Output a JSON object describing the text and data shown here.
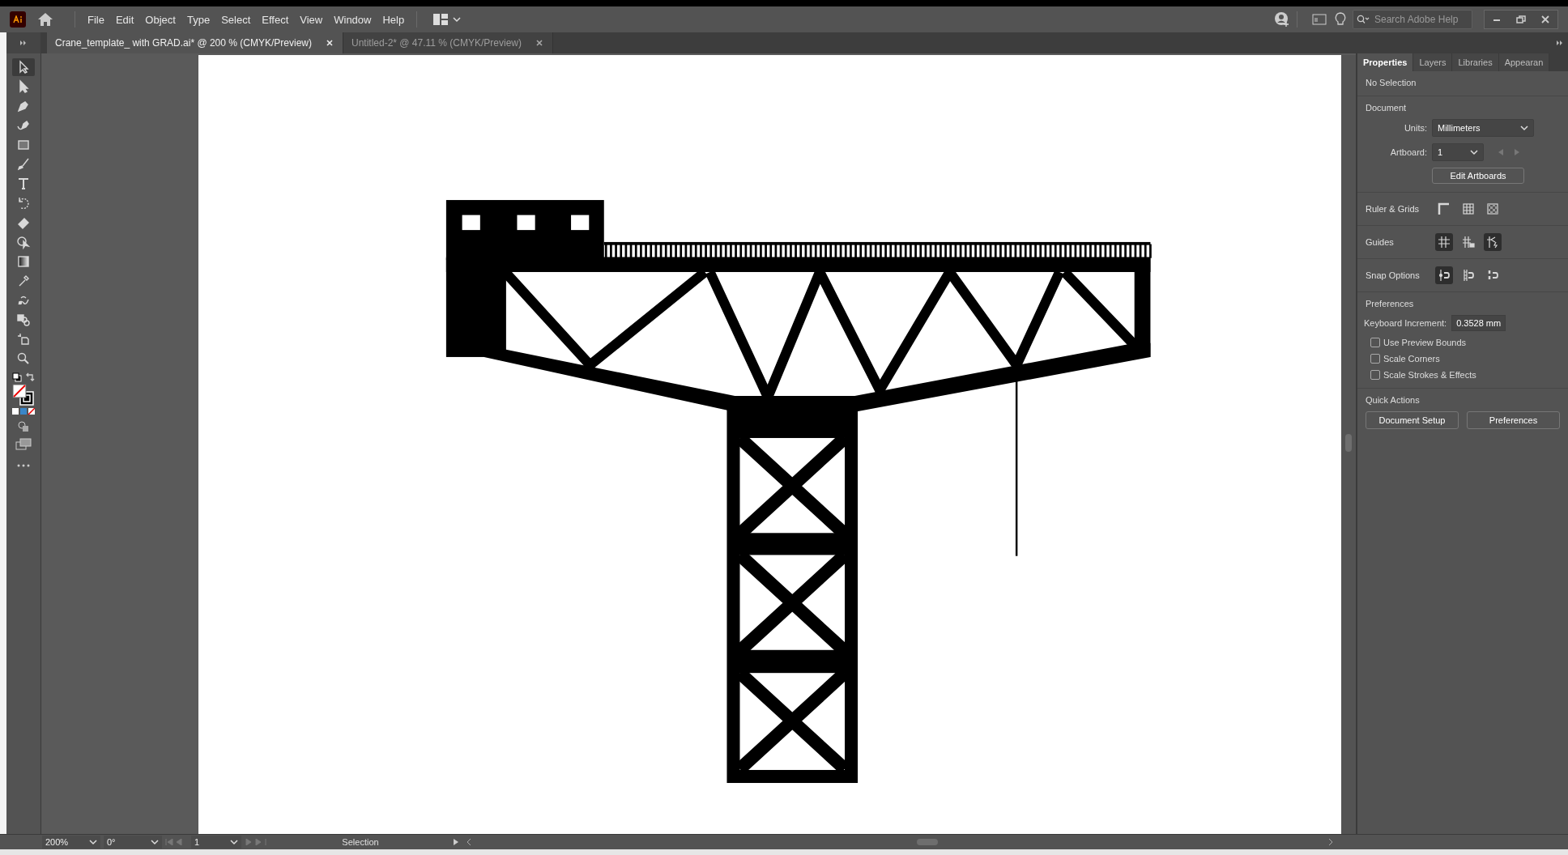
{
  "menu": [
    "File",
    "Edit",
    "Object",
    "Type",
    "Select",
    "Effect",
    "View",
    "Window",
    "Help"
  ],
  "search": {
    "placeholder": "Search Adobe Help"
  },
  "doc_tabs": [
    {
      "label": "Crane_template_ with GRAD.ai* @ 200 % (CMYK/Preview)",
      "selected": true
    },
    {
      "label": "Untitled-2* @ 47.11 % (CMYK/Preview)",
      "selected": false
    }
  ],
  "tools": [
    {
      "kind": "selection",
      "selected": true
    },
    {
      "kind": "direct",
      "selected": false
    },
    {
      "kind": "pen",
      "selected": false
    },
    {
      "kind": "curvature",
      "selected": false
    },
    {
      "kind": "rectangle",
      "selected": false
    },
    {
      "kind": "brush",
      "selected": false
    },
    {
      "kind": "type",
      "selected": false
    },
    {
      "kind": "rotate",
      "selected": false
    },
    {
      "kind": "eraser",
      "selected": false
    },
    {
      "kind": "shapebuilder",
      "selected": false
    },
    {
      "kind": "gradient",
      "selected": false
    },
    {
      "kind": "eyedropper",
      "selected": false
    },
    {
      "kind": "warp",
      "selected": false
    },
    {
      "kind": "shapes",
      "selected": false
    },
    {
      "kind": "artboard",
      "selected": false
    },
    {
      "kind": "zoom",
      "selected": false
    }
  ],
  "panel": {
    "tabs": [
      {
        "label": "Properties",
        "selected": true
      },
      {
        "label": "Layers",
        "selected": false
      },
      {
        "label": "Libraries",
        "selected": false
      },
      {
        "label": "Appearan",
        "selected": false
      }
    ],
    "selection": "No Selection",
    "document": {
      "heading": "Document",
      "units_label": "Units:",
      "units": "Millimeters",
      "artboard_label": "Artboard:",
      "artboard": "1",
      "edit_button": "Edit Artboards"
    },
    "icon_rows": [
      {
        "label": "Ruler & Grids",
        "icons": [
          {
            "kind": "ruler",
            "on": false
          },
          {
            "kind": "grid",
            "on": false
          },
          {
            "kind": "transparency",
            "on": false
          }
        ]
      },
      {
        "label": "Guides",
        "icons": [
          {
            "kind": "guides",
            "on": true
          },
          {
            "kind": "lockguides",
            "on": false
          },
          {
            "kind": "smartguides",
            "on": true
          }
        ]
      },
      {
        "label": "Snap Options",
        "icons": [
          {
            "kind": "snappoint",
            "on": true
          },
          {
            "kind": "snappixel",
            "on": false
          },
          {
            "kind": "snapglyph",
            "on": false
          }
        ]
      }
    ],
    "preferences": {
      "heading": "Preferences",
      "increment_label": "Keyboard Increment:",
      "increment": "0.3528 mm",
      "checkboxes": [
        {
          "label": "Use Preview Bounds",
          "checked": false
        },
        {
          "label": "Scale Corners",
          "checked": false
        },
        {
          "label": "Scale Strokes & Effects",
          "checked": false
        }
      ]
    },
    "quick_actions": {
      "heading": "Quick Actions",
      "buttons": [
        "Document Setup",
        "Preferences"
      ]
    }
  },
  "status_bar": {
    "zoom": "200%",
    "rotation": "0°",
    "artboard": "1",
    "tool": "Selection"
  }
}
